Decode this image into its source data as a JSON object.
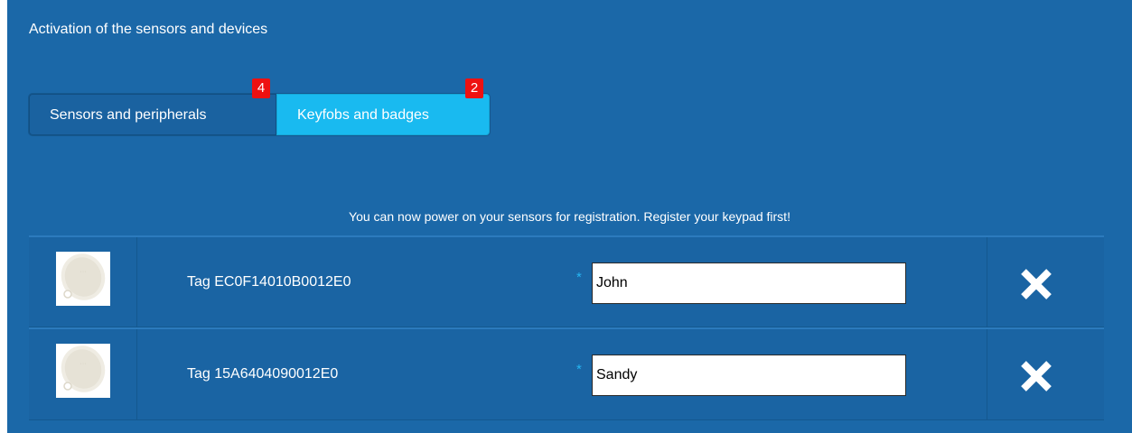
{
  "page": {
    "title": "Activation of the sensors and devices"
  },
  "tabs": [
    {
      "label": "Sensors and peripherals",
      "badge": "4",
      "active": false
    },
    {
      "label": "Keyfobs and badges",
      "badge": "2",
      "active": true
    }
  ],
  "notice": "You can now power on your sensors for registration. Register your keypad first!",
  "devices": [
    {
      "icon": "keyfob-tag-icon",
      "name": "Tag EC0F14010B0012E0",
      "required_marker": "*",
      "input_value": "John"
    },
    {
      "icon": "keyfob-tag-icon",
      "name": "Tag 15A6404090012E0",
      "required_marker": "*",
      "input_value": "Sandy"
    }
  ],
  "icons": {
    "delete": "close-x-icon"
  },
  "colors": {
    "panel_background": "#1b68a8",
    "active_tab": "#19baf0",
    "badge": "#ee1111",
    "required_marker": "#26b6f2"
  }
}
